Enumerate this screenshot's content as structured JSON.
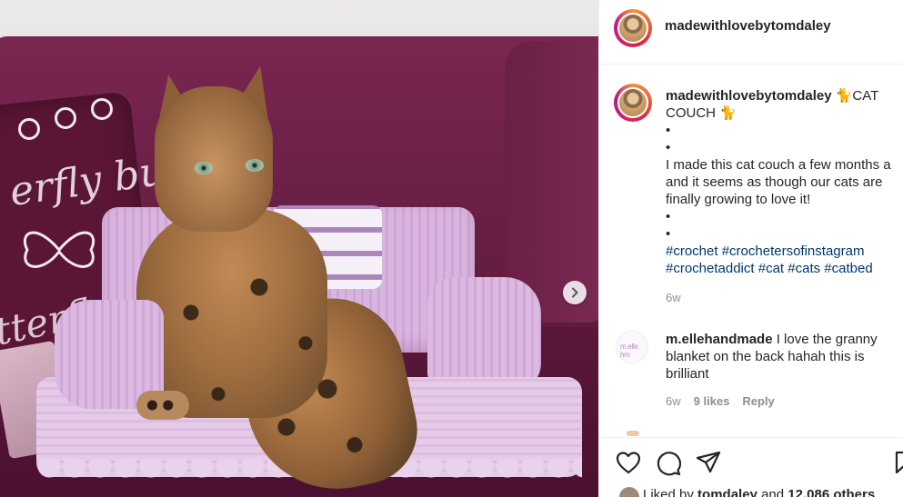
{
  "post": {
    "username": "madewithlovebytomdaley",
    "caption": {
      "username": "madewithlovebytomdaley",
      "title_emoji": "🐈",
      "title_text": "CAT",
      "title_text_2": "COUCH",
      "dot": "•",
      "body_line1": "I made this cat couch a few months a",
      "body_line2": "and it seems as though our cats are",
      "body_line3": "finally growing to love it!",
      "tags_line1": [
        "#crochet",
        "#crochetersofinstagram"
      ],
      "tags_line2": [
        "#crochetaddict",
        "#cat",
        "#cats",
        "#catbed"
      ],
      "time": "6w"
    },
    "comment": {
      "username": "m.ellehandmade",
      "text_1": "I love the granny",
      "text_2": "blanket on the back hahah this is",
      "text_3": "brilliant",
      "avatar_text": "m.elle hm",
      "time": "6w",
      "likes": "9 likes",
      "reply": "Reply"
    },
    "liked_by": {
      "prefix": "Liked by",
      "user": "tomdaley",
      "middle": "and",
      "others": "12,086 others"
    },
    "pillow_text_1": "erfly butte",
    "pillow_text_2": "tterfl"
  },
  "icons": {
    "like": "heart-icon",
    "comment": "comment-bubble-icon",
    "share": "paper-plane-icon",
    "save": "bookmark-icon",
    "next": "chevron-right-icon"
  },
  "colors": {
    "text": "#262626",
    "muted": "#8e8e8e",
    "hashtag": "#00376b",
    "border": "#efefef"
  }
}
